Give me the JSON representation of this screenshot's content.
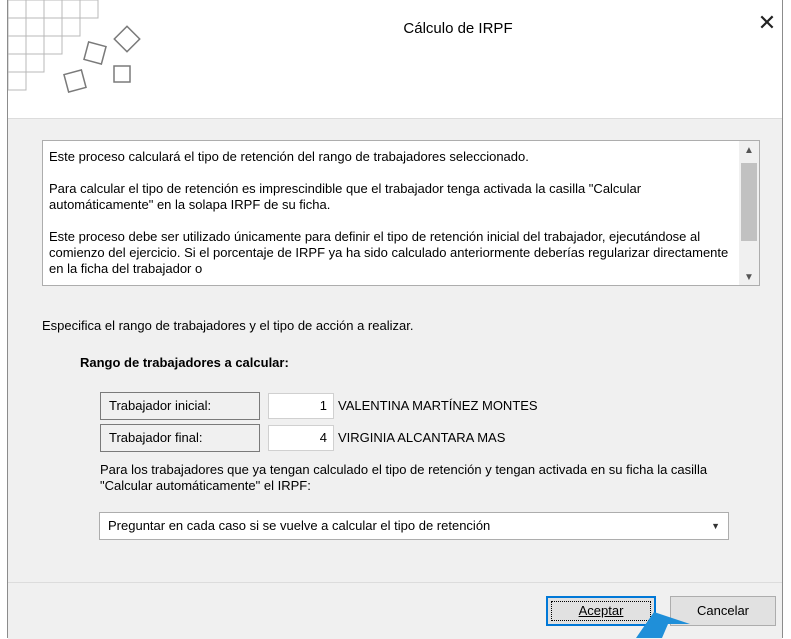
{
  "dialog": {
    "title": "Cálculo de IRPF",
    "close_icon": "close-icon"
  },
  "info": {
    "paragraphs": [
      "Este proceso calculará el tipo de retención del rango de trabajadores seleccionado.",
      "Para calcular el tipo de retención es imprescindible que el trabajador tenga activada la casilla \"Calcular automáticamente\" en la solapa IRPF de su ficha.",
      "Este proceso debe ser utilizado únicamente para definir el tipo de retención inicial del trabajador, ejecutándose al comienzo del ejercicio. Si el porcentaje de IRPF ya ha sido calculado anteriormente deberías regularizar directamente en la ficha del trabajador o"
    ]
  },
  "instruction": "Especifica el rango de trabajadores y el tipo de acción a realizar.",
  "range": {
    "title": "Rango de trabajadores a calcular:",
    "start": {
      "label": "Trabajador inicial:",
      "value": "1",
      "name": "VALENTINA MARTÍNEZ MONTES"
    },
    "end": {
      "label": "Trabajador final:",
      "value": "4",
      "name": "VIRGINIA ALCANTARA MAS"
    }
  },
  "action": {
    "description": "Para los trabajadores que ya tengan calculado el tipo de retención y tengan activada en su ficha la casilla \"Calcular automáticamente\" el IRPF:",
    "selected": "Preguntar en cada caso si se vuelve a calcular el tipo de retención"
  },
  "buttons": {
    "ok": "Aceptar",
    "cancel": "Cancelar"
  }
}
